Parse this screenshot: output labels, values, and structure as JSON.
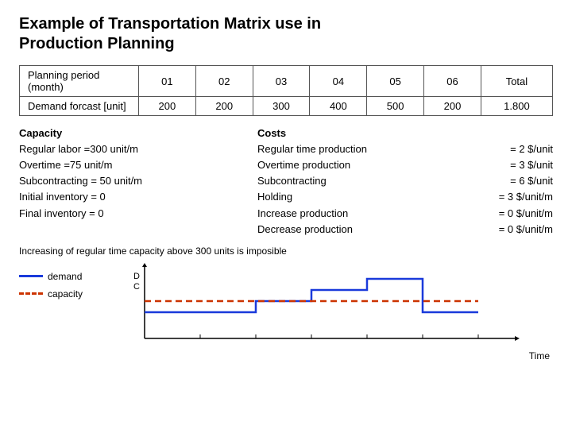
{
  "title": {
    "line1": "Example of Transportation Matrix use in",
    "line2": "Production Planning"
  },
  "table": {
    "headers": [
      "Planning period (month)",
      "01",
      "02",
      "03",
      "04",
      "05",
      "06",
      "Total"
    ],
    "row": {
      "label": "Demand forcast  [unit]",
      "values": [
        "200",
        "200",
        "300",
        "400",
        "500",
        "200",
        "1.800"
      ]
    }
  },
  "capacity": {
    "title": "Capacity",
    "items": [
      "Regular labor =300  unit/m",
      "Overtime =75  unit/m",
      "Subcontracting = 50  unit/m",
      "Initial inventory = 0",
      "Final inventory = 0"
    ]
  },
  "costs": {
    "title": "Costs",
    "items": [
      {
        "label": "Regular time production",
        "value": "= 2 $/unit"
      },
      {
        "label": "Overtime production",
        "value": "= 3 $/unit"
      },
      {
        "label": "Subcontracting",
        "value": "= 6 $/unit"
      },
      {
        "label": "Holding",
        "value": "= 3 $/unit/m"
      },
      {
        "label": "Increase production",
        "value": "= 0 $/unit/m"
      },
      {
        "label": "Decrease production",
        "value": "= 0 $/unit/m"
      }
    ]
  },
  "note": "Increasing of regular time capacity  above 300 units is imposible",
  "chart": {
    "dc_label": "D\nC",
    "time_label": "Time",
    "demand_label": "demand",
    "capacity_label": "capacity"
  }
}
